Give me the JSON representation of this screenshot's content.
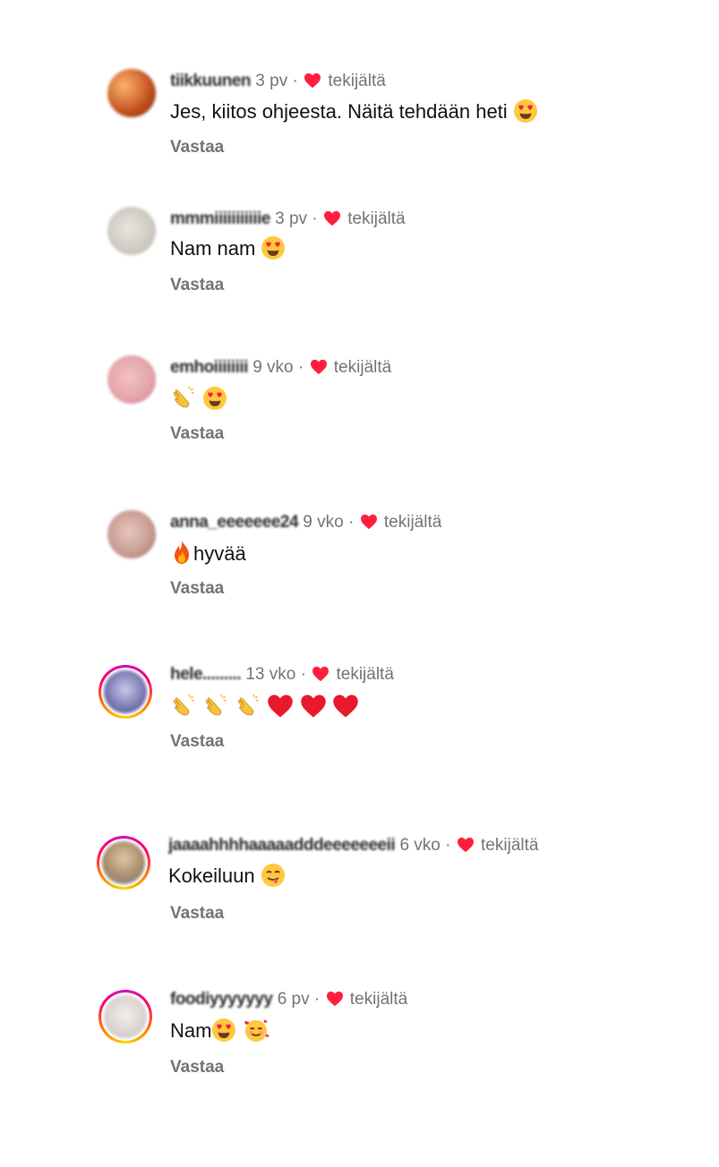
{
  "comments": [
    {
      "username": "tiikkuunen",
      "time": "3 pv",
      "sep": "·",
      "liked": "tekijältä",
      "text": "Jes, kiitos ohjeesta. Näitä tehdään heti",
      "emojis": [
        "heart-eyes"
      ],
      "reply": "Vastaa"
    },
    {
      "username": "mmmiiiiiiiiiiie",
      "time": "3 pv",
      "sep": "·",
      "liked": "tekijältä",
      "text": "Nam nam",
      "emojis": [
        "heart-eyes"
      ],
      "reply": "Vastaa"
    },
    {
      "username": "emhoiiiiiiii",
      "time": "9 vko",
      "sep": "·",
      "liked": "tekijältä",
      "text": "",
      "emojis": [
        "clap",
        "heart-eyes"
      ],
      "reply": "Vastaa"
    },
    {
      "username": "anna_eeeeeee24",
      "time": "9 vko",
      "sep": "·",
      "liked": "tekijältä",
      "text": "hyvää",
      "emojis_before": [
        "fire"
      ],
      "reply": "Vastaa"
    },
    {
      "username": "hele.........",
      "time": "13 vko",
      "sep": "·",
      "liked": "tekijältä",
      "text": "",
      "emojis": [
        "clap",
        "clap",
        "clap",
        "red-heart",
        "red-heart",
        "red-heart"
      ],
      "reply": "Vastaa"
    },
    {
      "username": "jaaaahhhhaaaaadddeeeeeeeii",
      "time": "6 vko",
      "sep": "·",
      "liked": "tekijältä",
      "text": "Kokeiluun",
      "emojis": [
        "yum"
      ],
      "reply": "Vastaa"
    },
    {
      "username": "foodiyyyyyyy",
      "time": "6 pv",
      "sep": "·",
      "liked": "tekijältä",
      "text": "Nam",
      "emojis": [
        "heart-eyes",
        "smiling-hearts"
      ],
      "reply": "Vastaa"
    }
  ],
  "colors": {
    "heart": "#ff1f3d",
    "muted": "#737373",
    "text": "#111111"
  }
}
